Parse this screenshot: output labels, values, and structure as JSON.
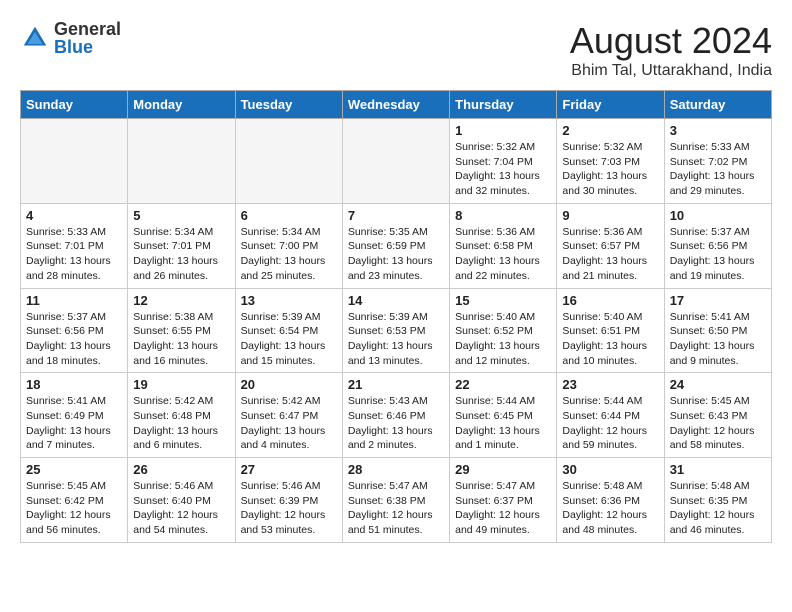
{
  "logo": {
    "general": "General",
    "blue": "Blue"
  },
  "title": "August 2024",
  "location": "Bhim Tal, Uttarakhand, India",
  "days_of_week": [
    "Sunday",
    "Monday",
    "Tuesday",
    "Wednesday",
    "Thursday",
    "Friday",
    "Saturday"
  ],
  "weeks": [
    [
      {
        "num": "",
        "info": ""
      },
      {
        "num": "",
        "info": ""
      },
      {
        "num": "",
        "info": ""
      },
      {
        "num": "",
        "info": ""
      },
      {
        "num": "1",
        "info": "Sunrise: 5:32 AM\nSunset: 7:04 PM\nDaylight: 13 hours and 32 minutes."
      },
      {
        "num": "2",
        "info": "Sunrise: 5:32 AM\nSunset: 7:03 PM\nDaylight: 13 hours and 30 minutes."
      },
      {
        "num": "3",
        "info": "Sunrise: 5:33 AM\nSunset: 7:02 PM\nDaylight: 13 hours and 29 minutes."
      }
    ],
    [
      {
        "num": "4",
        "info": "Sunrise: 5:33 AM\nSunset: 7:01 PM\nDaylight: 13 hours and 28 minutes."
      },
      {
        "num": "5",
        "info": "Sunrise: 5:34 AM\nSunset: 7:01 PM\nDaylight: 13 hours and 26 minutes."
      },
      {
        "num": "6",
        "info": "Sunrise: 5:34 AM\nSunset: 7:00 PM\nDaylight: 13 hours and 25 minutes."
      },
      {
        "num": "7",
        "info": "Sunrise: 5:35 AM\nSunset: 6:59 PM\nDaylight: 13 hours and 23 minutes."
      },
      {
        "num": "8",
        "info": "Sunrise: 5:36 AM\nSunset: 6:58 PM\nDaylight: 13 hours and 22 minutes."
      },
      {
        "num": "9",
        "info": "Sunrise: 5:36 AM\nSunset: 6:57 PM\nDaylight: 13 hours and 21 minutes."
      },
      {
        "num": "10",
        "info": "Sunrise: 5:37 AM\nSunset: 6:56 PM\nDaylight: 13 hours and 19 minutes."
      }
    ],
    [
      {
        "num": "11",
        "info": "Sunrise: 5:37 AM\nSunset: 6:56 PM\nDaylight: 13 hours and 18 minutes."
      },
      {
        "num": "12",
        "info": "Sunrise: 5:38 AM\nSunset: 6:55 PM\nDaylight: 13 hours and 16 minutes."
      },
      {
        "num": "13",
        "info": "Sunrise: 5:39 AM\nSunset: 6:54 PM\nDaylight: 13 hours and 15 minutes."
      },
      {
        "num": "14",
        "info": "Sunrise: 5:39 AM\nSunset: 6:53 PM\nDaylight: 13 hours and 13 minutes."
      },
      {
        "num": "15",
        "info": "Sunrise: 5:40 AM\nSunset: 6:52 PM\nDaylight: 13 hours and 12 minutes."
      },
      {
        "num": "16",
        "info": "Sunrise: 5:40 AM\nSunset: 6:51 PM\nDaylight: 13 hours and 10 minutes."
      },
      {
        "num": "17",
        "info": "Sunrise: 5:41 AM\nSunset: 6:50 PM\nDaylight: 13 hours and 9 minutes."
      }
    ],
    [
      {
        "num": "18",
        "info": "Sunrise: 5:41 AM\nSunset: 6:49 PM\nDaylight: 13 hours and 7 minutes."
      },
      {
        "num": "19",
        "info": "Sunrise: 5:42 AM\nSunset: 6:48 PM\nDaylight: 13 hours and 6 minutes."
      },
      {
        "num": "20",
        "info": "Sunrise: 5:42 AM\nSunset: 6:47 PM\nDaylight: 13 hours and 4 minutes."
      },
      {
        "num": "21",
        "info": "Sunrise: 5:43 AM\nSunset: 6:46 PM\nDaylight: 13 hours and 2 minutes."
      },
      {
        "num": "22",
        "info": "Sunrise: 5:44 AM\nSunset: 6:45 PM\nDaylight: 13 hours and 1 minute."
      },
      {
        "num": "23",
        "info": "Sunrise: 5:44 AM\nSunset: 6:44 PM\nDaylight: 12 hours and 59 minutes."
      },
      {
        "num": "24",
        "info": "Sunrise: 5:45 AM\nSunset: 6:43 PM\nDaylight: 12 hours and 58 minutes."
      }
    ],
    [
      {
        "num": "25",
        "info": "Sunrise: 5:45 AM\nSunset: 6:42 PM\nDaylight: 12 hours and 56 minutes."
      },
      {
        "num": "26",
        "info": "Sunrise: 5:46 AM\nSunset: 6:40 PM\nDaylight: 12 hours and 54 minutes."
      },
      {
        "num": "27",
        "info": "Sunrise: 5:46 AM\nSunset: 6:39 PM\nDaylight: 12 hours and 53 minutes."
      },
      {
        "num": "28",
        "info": "Sunrise: 5:47 AM\nSunset: 6:38 PM\nDaylight: 12 hours and 51 minutes."
      },
      {
        "num": "29",
        "info": "Sunrise: 5:47 AM\nSunset: 6:37 PM\nDaylight: 12 hours and 49 minutes."
      },
      {
        "num": "30",
        "info": "Sunrise: 5:48 AM\nSunset: 6:36 PM\nDaylight: 12 hours and 48 minutes."
      },
      {
        "num": "31",
        "info": "Sunrise: 5:48 AM\nSunset: 6:35 PM\nDaylight: 12 hours and 46 minutes."
      }
    ]
  ]
}
